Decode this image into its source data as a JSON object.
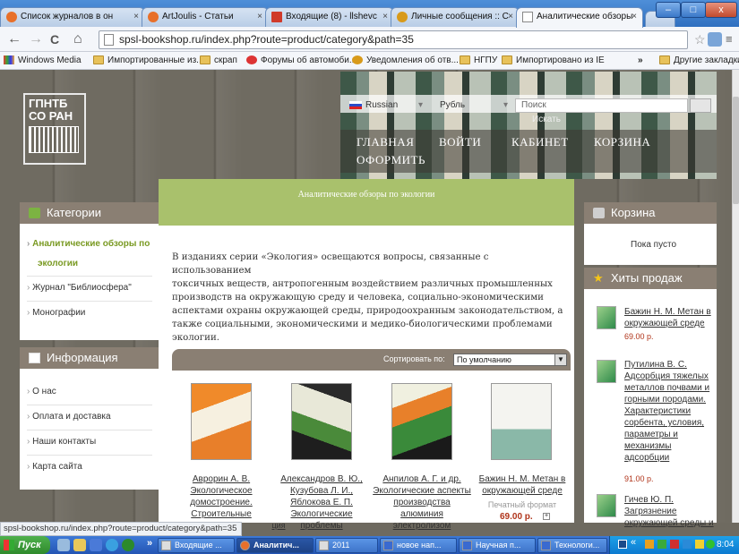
{
  "browser": {
    "tabs": [
      {
        "title": "Список журналов в он",
        "icon_color": "#e8702a"
      },
      {
        "title": "ArtJoulis - Статьи",
        "icon_color": "#e8702a"
      },
      {
        "title": "Входящие (8) - llshevc",
        "icon_color": "#d03a2a"
      },
      {
        "title": "Личные сообщения :: С",
        "icon_color": "#d89a1a"
      },
      {
        "title": "Аналитические обзоры",
        "icon_color": "#ffffff"
      }
    ],
    "window_buttons": {
      "minimize": "–",
      "restore": "□",
      "close": "x"
    },
    "nav": {
      "back": "←",
      "forward": "→",
      "reload": "C",
      "home": "⌂"
    },
    "url": "spsl-bookshop.ru/index.php?route=product/category&path=35",
    "bookmarks": [
      "Windows Media",
      "Импортированные из...",
      "скрап",
      "Форумы об автомоби...",
      "Уведомления об отв...",
      "НГПУ",
      "Импортировано из IE"
    ],
    "bookmarks_more": "»",
    "other_bookmarks": "Другие закладки",
    "status_url": "spsl-bookshop.ru/index.php?route=product/category&path=35"
  },
  "site": {
    "logo_line1": "ГПНТБ",
    "logo_line2": "СО РАН",
    "language": "Russian",
    "currency": "Рубль",
    "search_placeholder": "Поиск",
    "search_link": "Искать",
    "nav": [
      "ГЛАВНАЯ",
      "ВОЙТИ",
      "КАБИНЕТ",
      "КОРЗИНА",
      "ОФОРМИТЬ"
    ]
  },
  "left": {
    "categories_title": "Категории",
    "categories": [
      "Аналитические обзоры по",
      "экологии",
      "Журнал \"Библиосфера\"",
      "Монографии"
    ],
    "info_title": "Информация",
    "info": [
      "О нас",
      "Оплата и доставка",
      "Наши контакты",
      "Карта сайта"
    ]
  },
  "center": {
    "category_title": "Аналитические обзоры по экологии",
    "description_lines": [
      "В изданиях серии «Экология» освещаются вопросы, связанные с использованием",
      "токсичных веществ, антропогенным воздействием различных промышленных",
      "производств на окружающую среду и человека, социально-экономическими",
      "аспектами охраны окружающей среды, природоохранным законодательством, а",
      "также социальными, экономическими и медико-биологическими проблемами",
      "экологии."
    ],
    "sort_label": "Сортировать по:",
    "sort_value": "По умолчанию",
    "products": [
      {
        "lines": [
          "Аврорин А. В.",
          "Экологическое",
          "домостроение.",
          "Строительные"
        ],
        "extra": "ция"
      },
      {
        "lines": [
          "Александров В. Ю.,",
          "Кузубова Л. И.,",
          "Яблокова Е. П.",
          "Экологические",
          "проблемы"
        ]
      },
      {
        "lines": [
          "Анпилов А. Г. и др.",
          "Экологические аспекты",
          "производства",
          "алюминия",
          "электролизом"
        ]
      },
      {
        "lines": [
          "Бажин Н. М. Метан в",
          "окружающей среде"
        ],
        "format": "Печатный формат",
        "price": "69.00 р."
      }
    ]
  },
  "right": {
    "cart_title": "Корзина",
    "cart_empty": "Пока пусто",
    "hits_title": "Хиты продаж",
    "hits": [
      {
        "lines": [
          "Бажин Н. М. Метан в",
          "окружающей среде"
        ],
        "price": "69.00 р."
      },
      {
        "lines": [
          "Путилина В. С.",
          "Адсорбция тяжелых",
          "металлов почвами и",
          "горными породами.",
          "Характеристики",
          "сорбента, условия,",
          "параметры и",
          "механизмы",
          "адсорбции"
        ],
        "price": "91.00 р."
      },
      {
        "lines": [
          "Гичев Ю. П.",
          "Загрязнение",
          "окружающей среды и"
        ]
      }
    ]
  },
  "taskbar": {
    "start": "Пуск",
    "more": "»",
    "tasks": [
      "Входящие ...",
      "Аналитич...",
      "2011",
      "новое нап...",
      "Научная п...",
      "Технологи..."
    ],
    "clock": "8:04"
  }
}
